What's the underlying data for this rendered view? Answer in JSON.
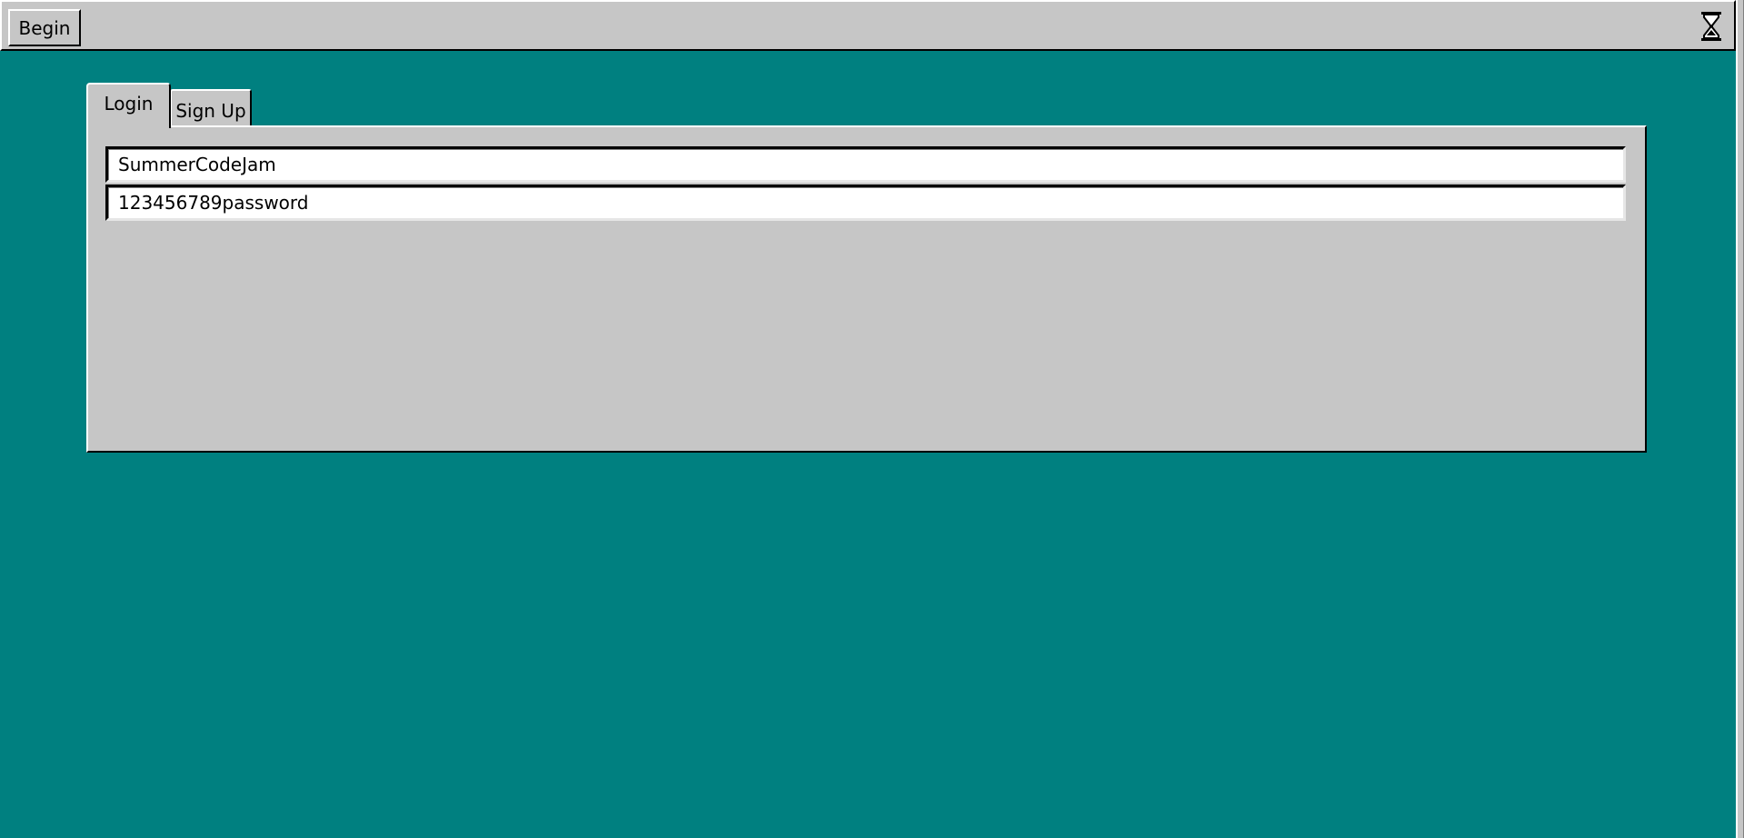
{
  "taskbar": {
    "begin_label": "Begin",
    "status_icon": "hourglass-icon"
  },
  "tabs": [
    {
      "label": "Login",
      "active": true
    },
    {
      "label": "Sign Up",
      "active": false
    }
  ],
  "login_form": {
    "username_value": "SummerCodeJam",
    "password_value": "123456789password"
  },
  "colors": {
    "desktop": "#008080",
    "panel": "#c6c6c6",
    "field": "#ffffff"
  }
}
